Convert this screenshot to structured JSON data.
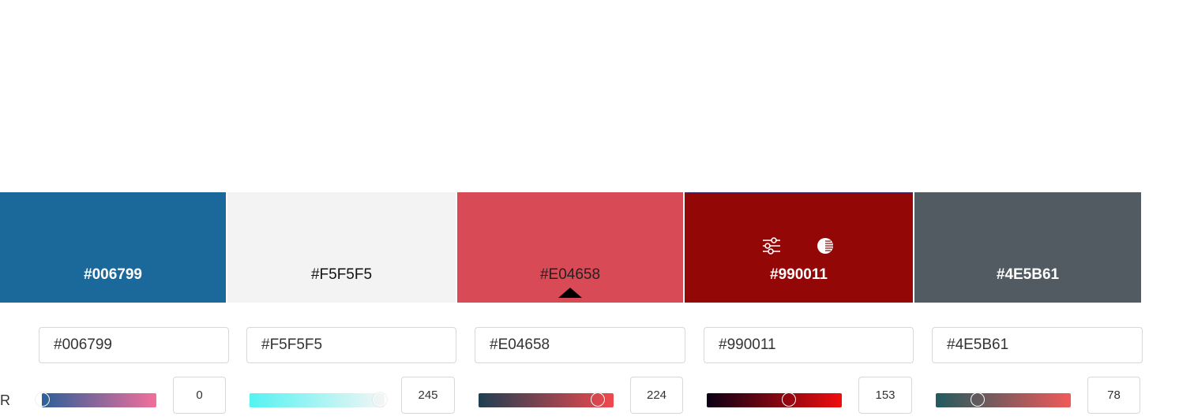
{
  "swatches": [
    {
      "hex": "#006799",
      "color": "#1b699b",
      "text_color": "#ffffff"
    },
    {
      "hex": "#F5F5F5",
      "color": "#f3f3f3",
      "text_color": "#111111"
    },
    {
      "hex": "#E04658",
      "color": "#d84a55",
      "text_color": "#222222"
    },
    {
      "hex": "#990011",
      "color": "#930706",
      "text_color": "#ffffff"
    },
    {
      "hex": "#4E5B61",
      "color": "#515b61",
      "text_color": "#ffffff"
    }
  ],
  "selected_swatch": "#E04658",
  "hovered_swatch_icons": [
    "sliders-icon",
    "contrast-icon"
  ],
  "inputs": [
    {
      "value": "#006799"
    },
    {
      "value": "#F5F5F5"
    },
    {
      "value": "#E04658"
    },
    {
      "value": "#990011"
    },
    {
      "value": "#4E5B61"
    }
  ],
  "channel": {
    "label": "R",
    "values": [
      "0",
      "245",
      "224",
      "153",
      "78"
    ],
    "fractions": [
      0.0,
      0.96,
      0.88,
      0.6,
      0.306
    ],
    "gradients": [
      [
        "#2c5f9a",
        "#f26f9b"
      ],
      [
        "#55f2f2",
        "#f5f5f5"
      ],
      [
        "#1e3f52",
        "#f0484e"
      ],
      [
        "#0a0015",
        "#f00d0d"
      ],
      [
        "#215b5f",
        "#f15a5a"
      ]
    ]
  }
}
